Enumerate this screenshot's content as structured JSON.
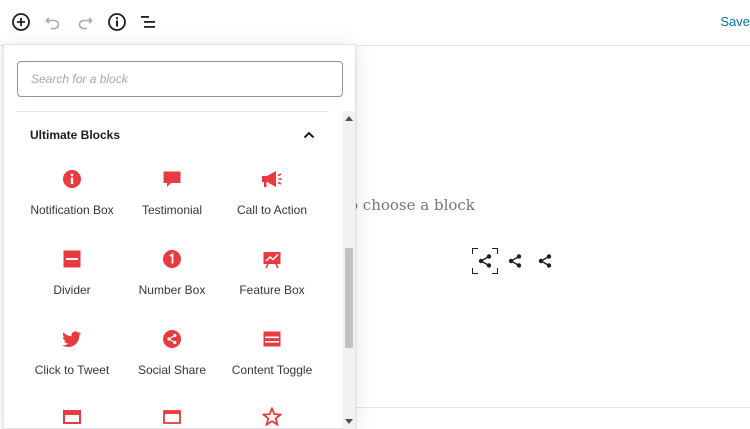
{
  "toolbar": {
    "add_block_icon": "plus-circle-icon",
    "undo_icon": "undo-icon",
    "redo_icon": "redo-icon",
    "info_icon": "info-icon",
    "outline_icon": "list-icon",
    "save_label": "Save"
  },
  "canvas": {
    "placeholder": "o choose a block",
    "share_icons": [
      "share-icon",
      "share-icon",
      "share-icon"
    ]
  },
  "inserter": {
    "search_placeholder": "Search for a block",
    "panel_title": "Ultimate Blocks",
    "panel_state_icon": "chevron-up-icon",
    "accent_color": "#e83a3f",
    "blocks": [
      {
        "label": "Notification Box",
        "icon": "info-circle-icon"
      },
      {
        "label": "Testimonial",
        "icon": "speech-bubble-icon"
      },
      {
        "label": "Call to Action",
        "icon": "megaphone-icon"
      },
      {
        "label": "Divider",
        "icon": "divider-icon"
      },
      {
        "label": "Number Box",
        "icon": "number-one-icon"
      },
      {
        "label": "Feature Box",
        "icon": "chart-board-icon"
      },
      {
        "label": "Click to Tweet",
        "icon": "twitter-icon"
      },
      {
        "label": "Social Share",
        "icon": "share-circle-icon"
      },
      {
        "label": "Content Toggle",
        "icon": "toggle-panels-icon"
      },
      {
        "label": "",
        "icon": "tab-box-icon"
      },
      {
        "label": "",
        "icon": "browser-window-icon"
      },
      {
        "label": "",
        "icon": "star-icon"
      }
    ]
  }
}
